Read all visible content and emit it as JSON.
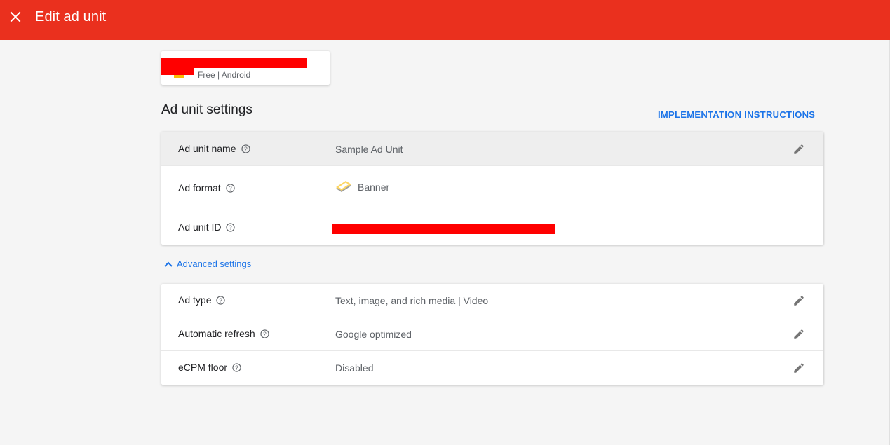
{
  "topbar": {
    "title": "Edit ad unit",
    "close_icon": "close-icon",
    "color": "#ea301e"
  },
  "app": {
    "name": "",
    "subtitle": "Free | Android"
  },
  "settings": {
    "title": "Ad unit settings",
    "implementation_link": "IMPLEMENTATION INSTRUCTIONS",
    "rows": [
      {
        "label": "Ad unit name",
        "value": "Sample Ad Unit",
        "editable": true
      },
      {
        "label": "Ad format",
        "value": "Banner",
        "icon": "banner-icon",
        "editable": false
      },
      {
        "label": "Ad unit ID",
        "value": "",
        "editable": false
      }
    ]
  },
  "advanced": {
    "toggle_label": "Advanced settings",
    "rows": [
      {
        "label": "Ad type",
        "value": "Text, image, and rich media | Video",
        "editable": true
      },
      {
        "label": "Automatic refresh",
        "value": "Google optimized",
        "editable": true
      },
      {
        "label": "eCPM floor",
        "value": "Disabled",
        "editable": true
      }
    ]
  },
  "colors": {
    "accent": "#1a73e8",
    "header": "#ea301e",
    "redaction": "#ff0000"
  }
}
